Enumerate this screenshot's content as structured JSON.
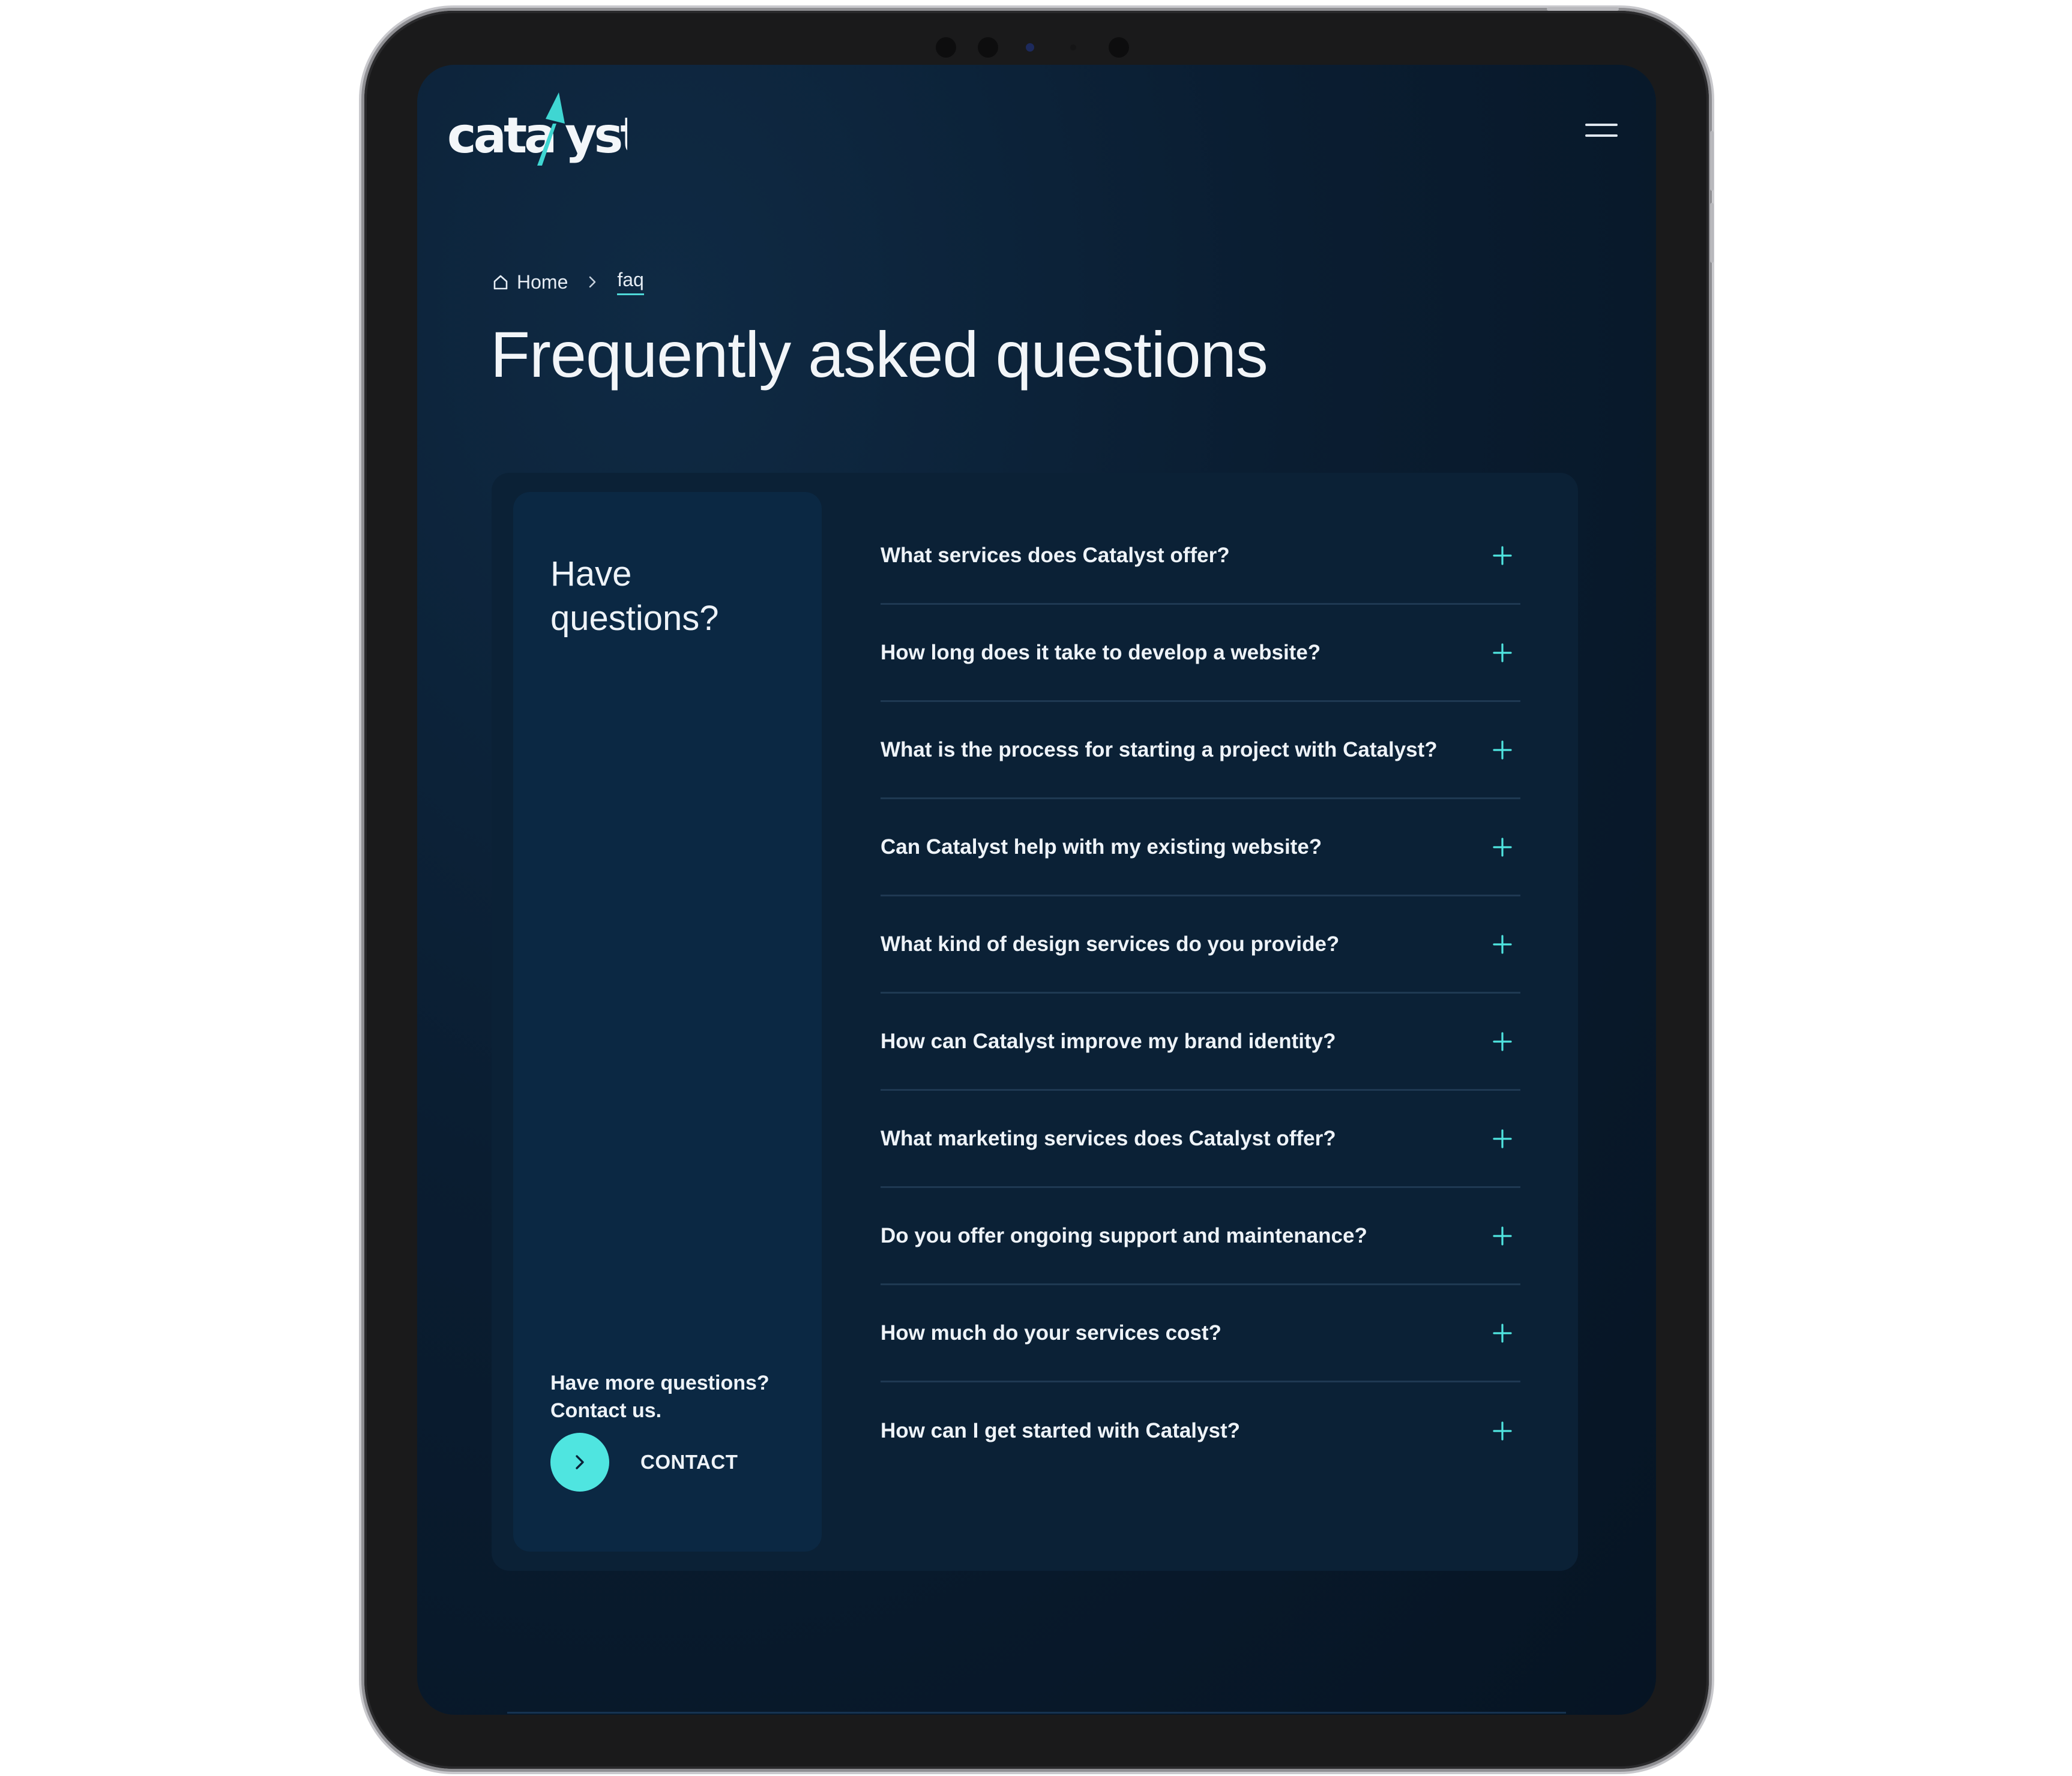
{
  "brand": {
    "logo_text": "catalyst",
    "accent_color": "#4fe5e0"
  },
  "header": {
    "menu_icon": "hamburger-icon"
  },
  "breadcrumb": {
    "home_label": "Home",
    "current_label": "faq",
    "home_icon": "home-icon",
    "separator_icon": "chevron-right-icon"
  },
  "page": {
    "title": "Frequently asked questions"
  },
  "sidebar": {
    "title": "Have questions?",
    "more_text": "Have more questions? Contact us.",
    "contact_label": "CONTACT",
    "contact_icon": "chevron-right-icon"
  },
  "faq": {
    "expand_icon": "plus-icon",
    "items": [
      {
        "question": "What services does Catalyst offer?"
      },
      {
        "question": "How long does it take to develop a website?"
      },
      {
        "question": "What is the process for starting a project with Catalyst?"
      },
      {
        "question": "Can Catalyst help with my existing website?"
      },
      {
        "question": "What kind of design services do you provide?"
      },
      {
        "question": "How can Catalyst improve my brand identity?"
      },
      {
        "question": "What marketing services does Catalyst offer?"
      },
      {
        "question": "Do you offer ongoing support and maintenance?"
      },
      {
        "question": "How much do your services cost?"
      },
      {
        "question": "How can I get started with Catalyst?"
      }
    ]
  }
}
